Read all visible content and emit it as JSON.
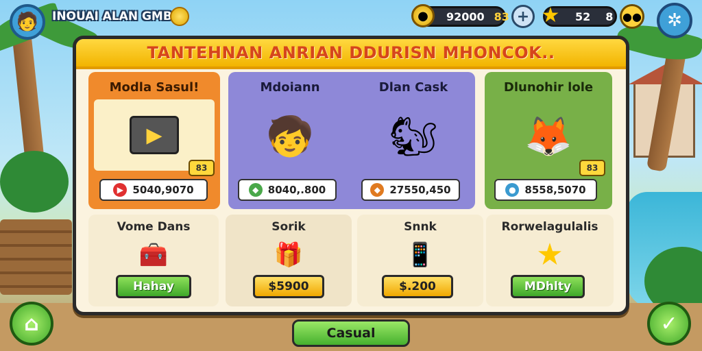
{
  "top_bar": {
    "player_name": "INOUAI ALAN GMB",
    "currency": {
      "amount": "92000",
      "extra": "83"
    },
    "stars": {
      "count": "52",
      "extra": "8"
    },
    "icons": {
      "avatar": "avatar-icon",
      "coin": "coin-icon",
      "add": "plus-icon",
      "star": "star-icon",
      "chat": "chat-icon",
      "settings": "settings-icon"
    }
  },
  "panel": {
    "title": "TANTEHNAN ANRIAN DDURISN MHONCOK.."
  },
  "featured_cards": [
    {
      "title": "Modla Sasul!",
      "badge": "83",
      "price": "5040,9070",
      "icon": "video-icon",
      "art": "tablet-play-icon",
      "bg": "#f08a2c"
    },
    {
      "title": "Mdoiann",
      "price": "8040,.800",
      "icon": "gem-icon",
      "art": "kid-character",
      "bg": "#8e88d8"
    },
    {
      "title": "Dlan Cask",
      "price": "27550,450",
      "icon": "gem-icon",
      "art": "squirrel-character",
      "bg": "#8e88d8"
    },
    {
      "title": "Dlunohir lole",
      "badge": "83",
      "price": "8558,5070",
      "icon": "coin-icon",
      "art": "fox-chest-character",
      "bg": "#78b048"
    }
  ],
  "offers": [
    {
      "title": "Vome Dans",
      "button": "Hahay",
      "style": "green",
      "art": "treasure-chest-icon"
    },
    {
      "title": "Sorik",
      "button": "$5900",
      "style": "yellow",
      "art": "gift-box-icon"
    },
    {
      "title": "Snnk",
      "button": "$.200",
      "style": "yellow",
      "art": "phone-icon"
    },
    {
      "title": "Rorwelagulalis",
      "button": "MDhlty",
      "style": "green",
      "art": "star-icon"
    }
  ],
  "bottom": {
    "casual_label": "Casual",
    "home_icon": "home-icon",
    "confirm_icon": "check-icon"
  },
  "colors": {
    "panel_header": "#f2b400",
    "title_text": "#d6451c",
    "green_button": "#3fa82a",
    "yellow_button": "#f0a800"
  }
}
